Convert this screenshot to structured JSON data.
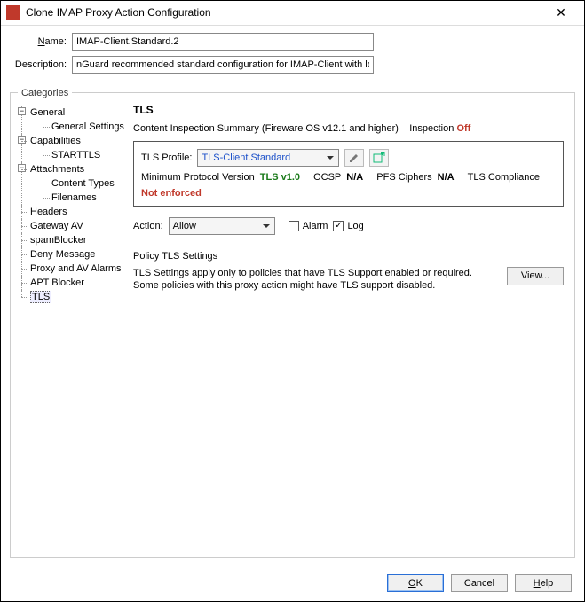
{
  "window": {
    "title": "Clone IMAP Proxy Action Configuration"
  },
  "form": {
    "name_label": "Name:",
    "name_value": "IMAP-Client.Standard.2",
    "desc_label": "Description:",
    "desc_value": "nGuard recommended standard configuration for IMAP-Client with logging enabled"
  },
  "categories_legend": "Categories",
  "tree": {
    "general": "General",
    "general_settings": "General Settings",
    "capabilities": "Capabilities",
    "starttls": "STARTTLS",
    "attachments": "Attachments",
    "content_types": "Content Types",
    "filenames": "Filenames",
    "headers": "Headers",
    "gateway_av": "Gateway AV",
    "spamblocker": "spamBlocker",
    "deny_message": "Deny Message",
    "proxy_av_alarms": "Proxy and AV Alarms",
    "apt_blocker": "APT Blocker",
    "tls": "TLS"
  },
  "tls": {
    "heading": "TLS",
    "summary_label": "Content Inspection Summary (Fireware OS v12.1 and higher)",
    "inspection_label": "Inspection",
    "inspection_value": "Off",
    "profile_label": "TLS Profile:",
    "profile_value": "TLS-Client.Standard",
    "min_proto_label": "Minimum Protocol Version",
    "min_proto_value": "TLS v1.0",
    "ocsp_label": "OCSP",
    "ocsp_value": "N/A",
    "pfs_label": "PFS Ciphers",
    "pfs_value": "N/A",
    "compliance_label": "TLS Compliance",
    "compliance_value": "Not enforced",
    "action_label": "Action:",
    "action_value": "Allow",
    "alarm_label": "Alarm",
    "log_label": "Log",
    "policy_heading": "Policy TLS Settings",
    "policy_text1": "TLS Settings apply only to policies that have TLS Support enabled or required.",
    "policy_text2": "Some policies with this proxy action might have TLS support disabled.",
    "view_button": "View..."
  },
  "footer": {
    "ok": "OK",
    "cancel": "Cancel",
    "help": "Help"
  }
}
